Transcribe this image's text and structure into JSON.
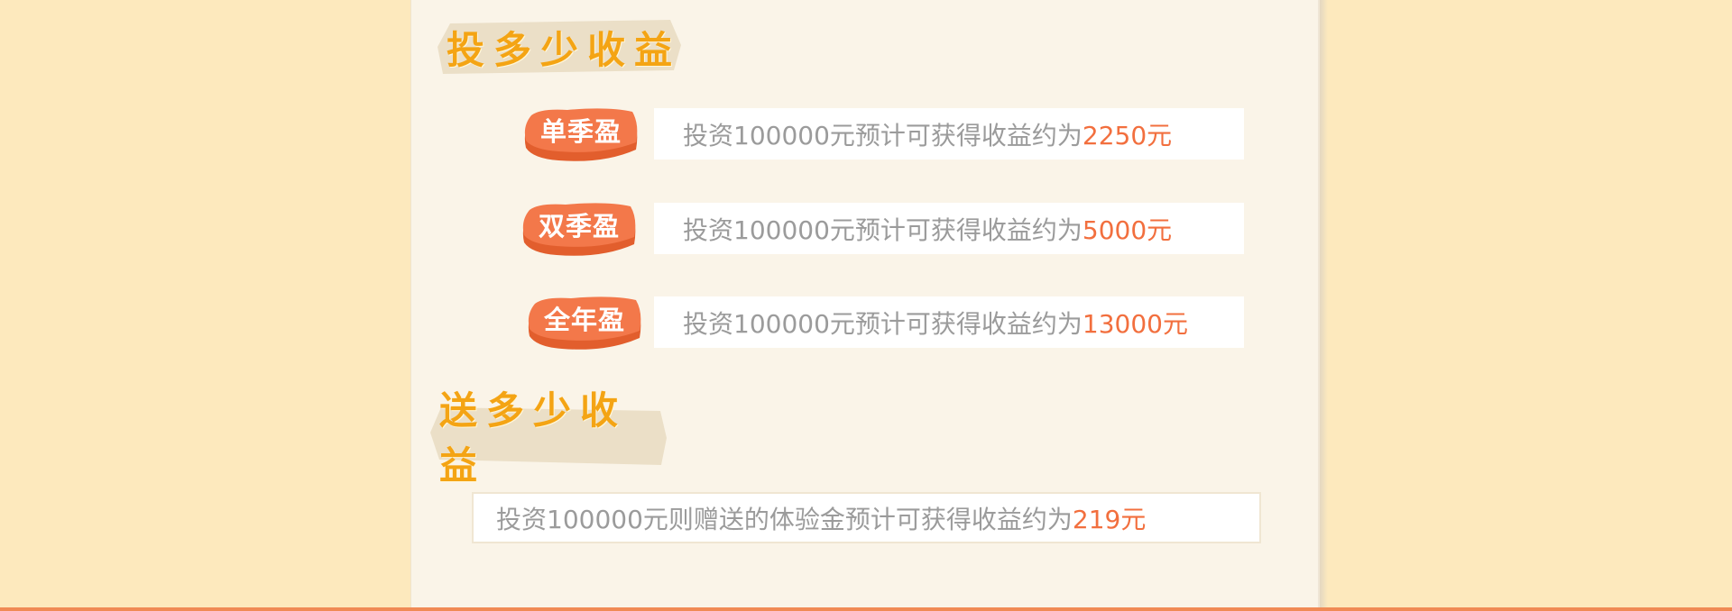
{
  "sections": {
    "invest": {
      "title": "投多少收益"
    },
    "gift": {
      "title": "送多少收益"
    }
  },
  "plans": [
    {
      "name": "单季盈",
      "text": "投资100000元预计可获得收益约为",
      "amount": "2250元"
    },
    {
      "name": "双季盈",
      "text": "投资100000元预计可获得收益约为",
      "amount": "5000元"
    },
    {
      "name": "全年盈",
      "text": "投资100000元预计可获得收益约为",
      "amount": "13000元"
    }
  ],
  "gift_info": {
    "text": "投资100000元则赠送的体验金预计可获得收益约为",
    "amount": "219元"
  },
  "colors": {
    "background": "#fde9bd",
    "paper": "#faf4e8",
    "title": "#f4a414",
    "badge": "#f3784a",
    "highlight": "#f26f3e",
    "body_text": "#9b9b9b"
  }
}
